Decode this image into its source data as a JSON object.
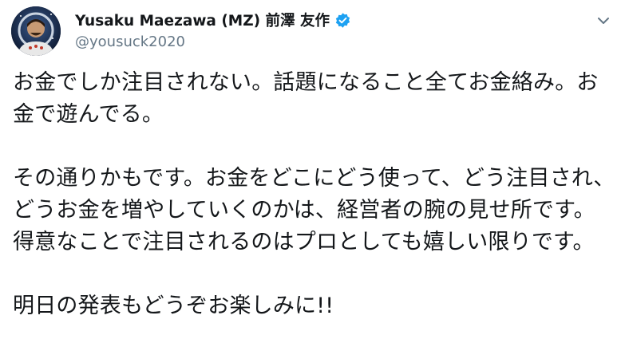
{
  "author": {
    "display_name": "Yusaku Maezawa (MZ) 前澤 友作",
    "handle": "@yousuck2020",
    "verified": true,
    "avatar_icon": "astronaut-avatar",
    "verified_icon": "verified-badge-icon",
    "menu_icon": "chevron-down-icon"
  },
  "tweet": {
    "paragraphs": [
      [
        "お金でしか注目されない。話題になること全てお金絡み。お",
        "金で遊んでる。"
      ],
      [
        "その通りかもです。お金をどこにどう使って、どう注目され、",
        "どうお金を増やしていくのかは、経営者の腕の見せ所です。",
        "得意なことで注目されるのはプロとしても嬉しい限りです。"
      ],
      [
        "明日の発表もどうぞお楽しみに!!"
      ]
    ]
  },
  "colors": {
    "text": "#14171a",
    "secondary": "#657786",
    "accent": "#1da1f2"
  }
}
